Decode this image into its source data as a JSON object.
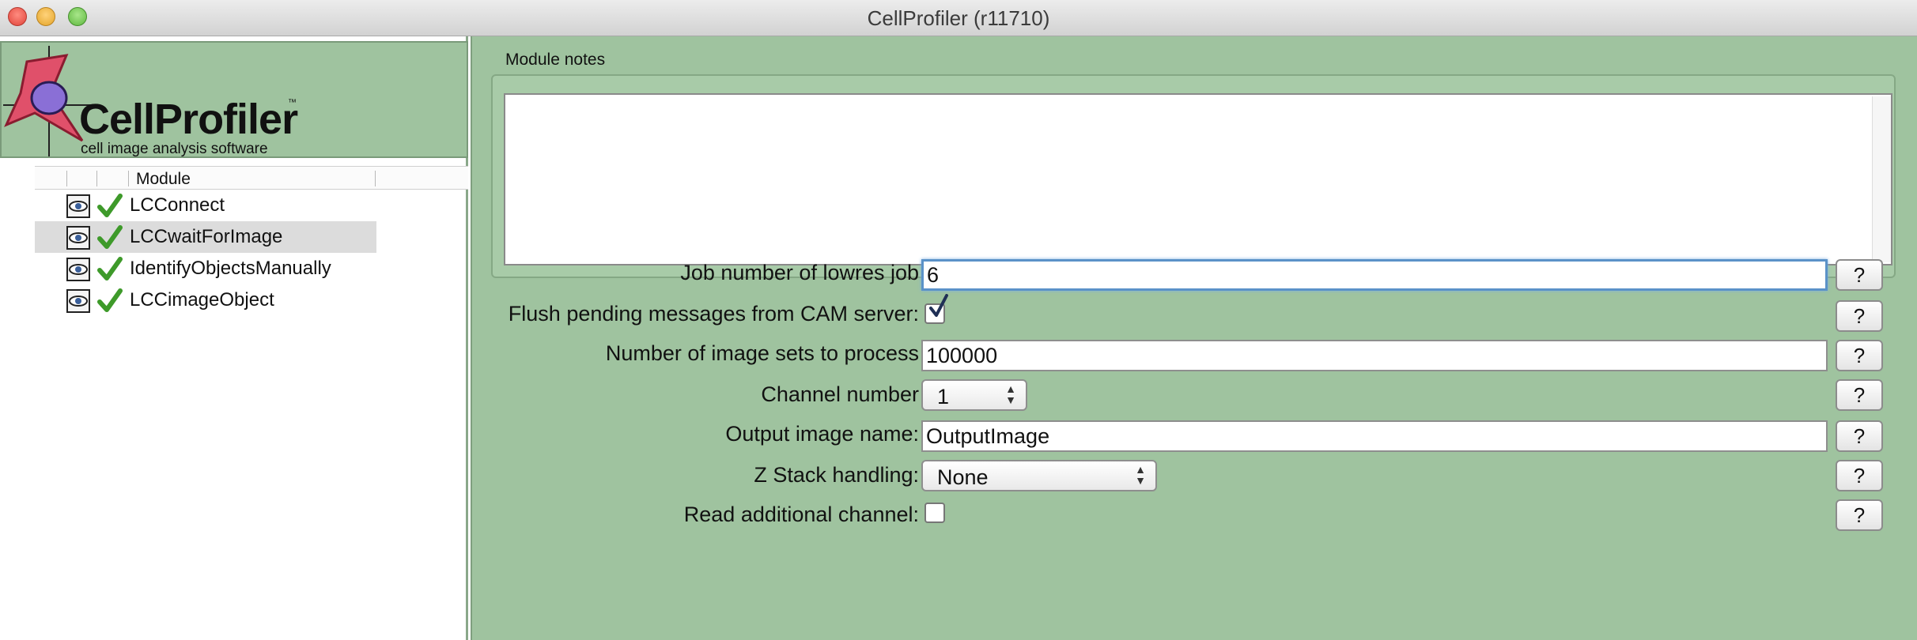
{
  "window": {
    "title": "CellProfiler (r11710)"
  },
  "logo": {
    "name": "CellProfiler",
    "trademark": "™",
    "tagline": "cell image analysis software"
  },
  "pipeline": {
    "column_header": "Module",
    "modules": [
      {
        "name": "LCConnect",
        "selected": false
      },
      {
        "name": "LCCwaitForImage",
        "selected": true
      },
      {
        "name": "IdentifyObjectsManually",
        "selected": false
      },
      {
        "name": "LCCimageObject",
        "selected": false
      }
    ]
  },
  "module_notes": {
    "label": "Module notes",
    "value": ""
  },
  "settings": {
    "job_number": {
      "label": "Job number of lowres job",
      "value": "6"
    },
    "flush_pending": {
      "label": "Flush pending messages from CAM server:",
      "checked": true
    },
    "image_sets": {
      "label": "Number of image sets to process",
      "value": "100000"
    },
    "channel_number": {
      "label": "Channel number",
      "value": "1"
    },
    "output_image": {
      "label": "Output image name:",
      "value": "OutputImage"
    },
    "z_stack": {
      "label": "Z Stack handling:",
      "value": "None"
    },
    "read_additional": {
      "label": "Read additional channel:",
      "checked": false
    },
    "help_label": "?"
  },
  "colors": {
    "panel_green": "#9fc39f",
    "selection_gray": "#dcdcdc",
    "focus_blue": "#5b92c8"
  },
  "icons": {
    "module_enabled": "eye-icon",
    "module_valid": "checkmark-icon"
  }
}
